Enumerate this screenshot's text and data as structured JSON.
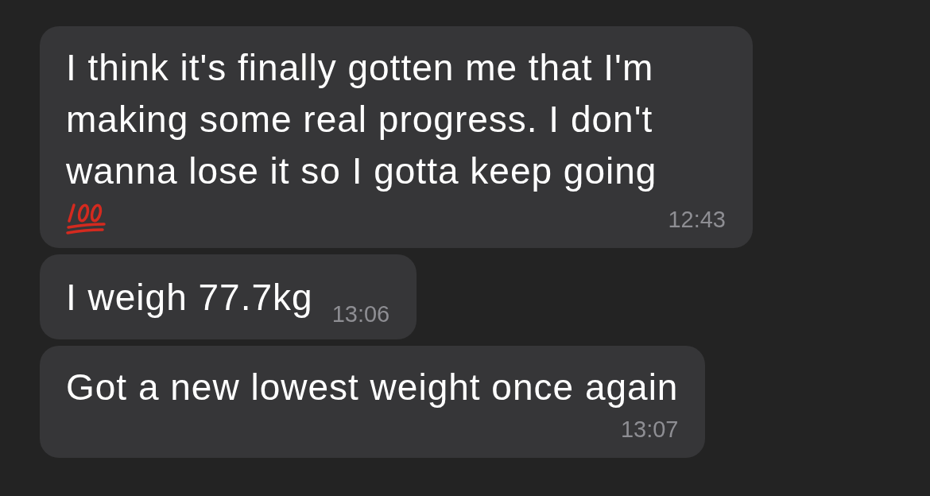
{
  "messages": [
    {
      "kind": "block",
      "text": "I think it's finally gotten me that I'm making some real progress. I don't wanna lose it so I gotta keep going",
      "has_emoji": true,
      "time": "12:43"
    },
    {
      "kind": "inline",
      "text": "I weigh 77.7kg",
      "has_emoji": false,
      "time": "13:06"
    },
    {
      "kind": "block",
      "text": "Got a new lowest weight once again",
      "has_emoji": false,
      "time": "13:07"
    }
  ]
}
